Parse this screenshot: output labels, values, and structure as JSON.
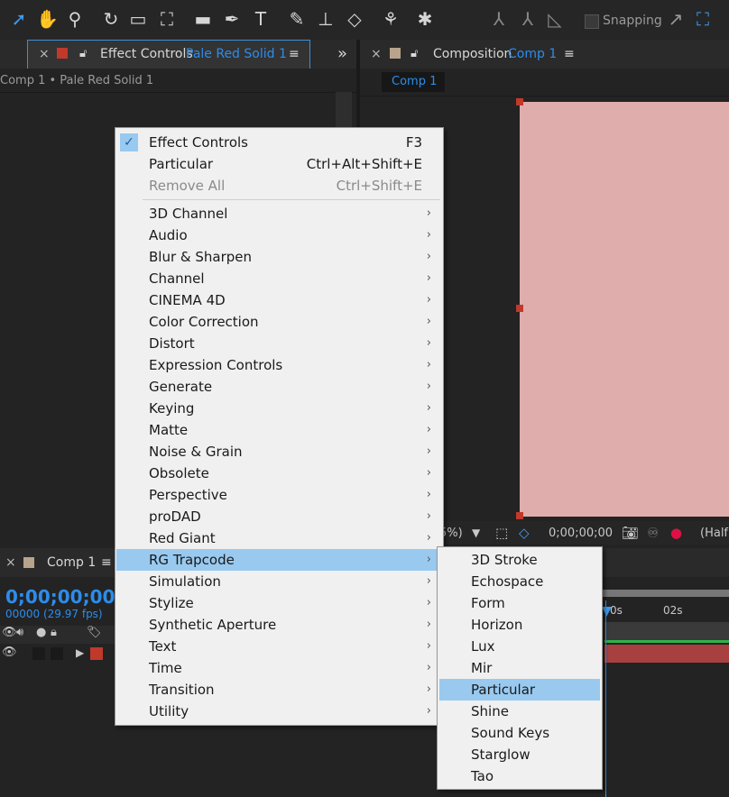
{
  "toolbar": {
    "snapping_label": "Snapping",
    "tools": [
      "selection-tool",
      "hand-tool",
      "zoom-tool",
      "rotate-tool",
      "camera-tool",
      "pan-behind-tool",
      "rectangle-tool",
      "pen-tool",
      "type-tool",
      "brush-tool",
      "clone-stamp-tool",
      "eraser-tool",
      "roto-brush-tool",
      "puppet-pin-tool"
    ]
  },
  "effect_panel": {
    "close": "×",
    "title": "Effect Controls",
    "layer": "Pale Red Solid 1",
    "menu_glyph": "≡",
    "overflow": "»",
    "breadcrumb": "Comp 1 • Pale Red Solid 1"
  },
  "comp_panel": {
    "close": "×",
    "title": "Composition",
    "comp": "Comp 1",
    "menu_glyph": "≡",
    "tab_label": "Comp 1",
    "zoom": "5%)",
    "timecode": "0;00;00;00",
    "resolution": "(Half",
    "solid_color": "#e0adad"
  },
  "timeline": {
    "close": "×",
    "title": "Comp 1",
    "menu_glyph": "≡",
    "timecode": "0;00;00;00",
    "frames": "00000 (29.97 fps)",
    "ruler_0": "0s",
    "ruler_2": "02s"
  },
  "menu": {
    "items": [
      {
        "label": "Effect Controls",
        "shortcut": "F3",
        "checked": true
      },
      {
        "label": "Particular",
        "shortcut": "Ctrl+Alt+Shift+E"
      },
      {
        "label": "Remove All",
        "shortcut": "Ctrl+Shift+E",
        "disabled": true
      },
      {
        "label": "3D Channel",
        "arrow": "›"
      },
      {
        "label": "Audio",
        "arrow": "›"
      },
      {
        "label": "Blur & Sharpen",
        "arrow": "›"
      },
      {
        "label": "Channel",
        "arrow": "›"
      },
      {
        "label": "CINEMA 4D",
        "arrow": "›"
      },
      {
        "label": "Color Correction",
        "arrow": "›"
      },
      {
        "label": "Distort",
        "arrow": "›"
      },
      {
        "label": "Expression Controls",
        "arrow": "›"
      },
      {
        "label": "Generate",
        "arrow": "›"
      },
      {
        "label": "Keying",
        "arrow": "›"
      },
      {
        "label": "Matte",
        "arrow": "›"
      },
      {
        "label": "Noise & Grain",
        "arrow": "›"
      },
      {
        "label": "Obsolete",
        "arrow": "›"
      },
      {
        "label": "Perspective",
        "arrow": "›"
      },
      {
        "label": "proDAD",
        "arrow": "›"
      },
      {
        "label": "Red Giant",
        "arrow": "›"
      },
      {
        "label": "RG Trapcode",
        "arrow": "›",
        "highlighted": true
      },
      {
        "label": "Simulation",
        "arrow": "›"
      },
      {
        "label": "Stylize",
        "arrow": "›"
      },
      {
        "label": "Synthetic Aperture",
        "arrow": "›"
      },
      {
        "label": "Text",
        "arrow": "›"
      },
      {
        "label": "Time",
        "arrow": "›"
      },
      {
        "label": "Transition",
        "arrow": "›"
      },
      {
        "label": "Utility",
        "arrow": "›"
      }
    ],
    "check_glyph": "✓"
  },
  "submenu": {
    "items": [
      {
        "label": "3D Stroke"
      },
      {
        "label": "Echospace"
      },
      {
        "label": "Form"
      },
      {
        "label": "Horizon"
      },
      {
        "label": "Lux"
      },
      {
        "label": "Mir"
      },
      {
        "label": "Particular",
        "highlighted": true
      },
      {
        "label": "Shine"
      },
      {
        "label": "Sound Keys"
      },
      {
        "label": "Starglow"
      },
      {
        "label": "Tao"
      }
    ]
  }
}
